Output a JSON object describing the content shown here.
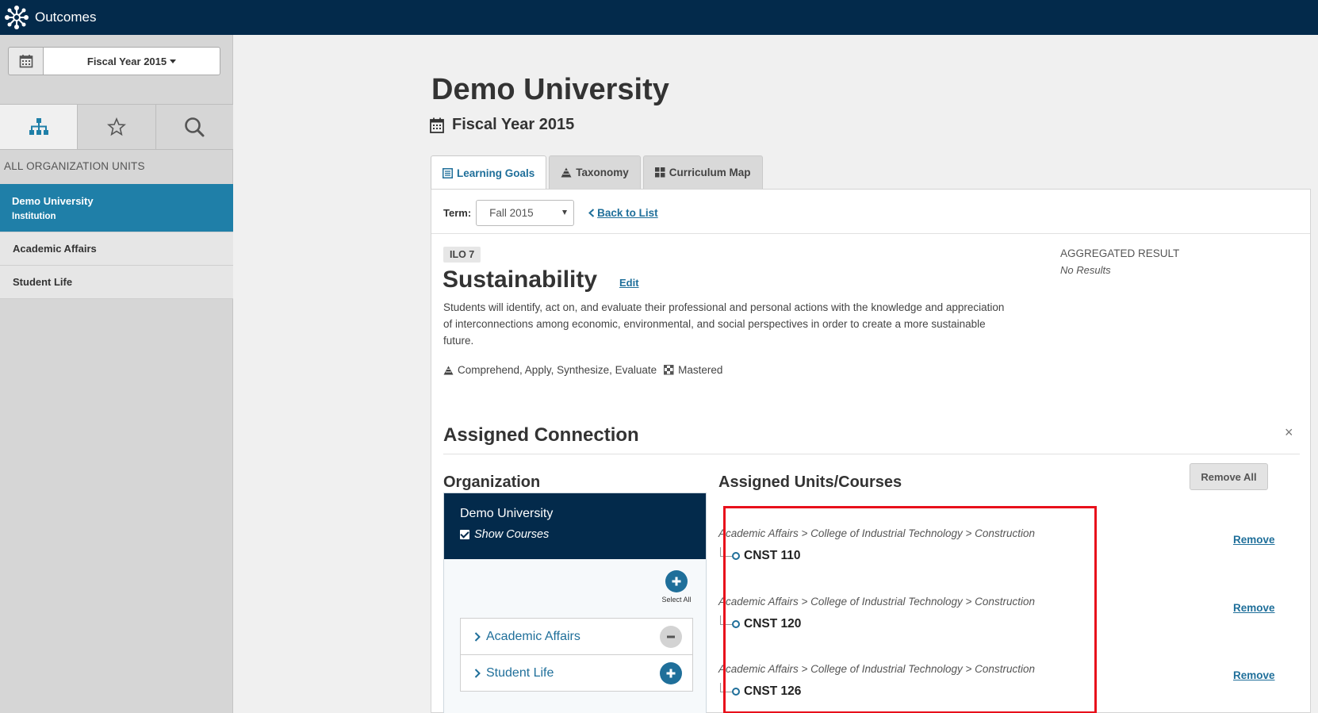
{
  "topbar": {
    "app_title": "Outcomes"
  },
  "sidebar": {
    "fiscal_year_label": "Fiscal Year 2015",
    "heading": "ALL ORGANIZATION UNITS",
    "tabs": [
      {
        "icon": "org-chart-icon"
      },
      {
        "icon": "star-icon"
      },
      {
        "icon": "search-icon"
      }
    ],
    "units": [
      {
        "name": "Demo University",
        "type": "Institution"
      },
      {
        "name": "Academic Affairs"
      },
      {
        "name": "Student Life"
      }
    ]
  },
  "page": {
    "title": "Demo University",
    "fiscal_year": "Fiscal Year 2015"
  },
  "tabs": [
    {
      "label": "Learning Goals",
      "icon": "list-icon"
    },
    {
      "label": "Taxonomy",
      "icon": "pyramid-icon"
    },
    {
      "label": "Curriculum Map",
      "icon": "grid-icon"
    }
  ],
  "term": {
    "label": "Term:",
    "selected": "Fall 2015",
    "back_label": "Back to List"
  },
  "goal": {
    "badge": "ILO 7",
    "title": "Sustainability",
    "edit_label": "Edit",
    "description": "Students will identify, act on, and evaluate their professional and personal actions with the knowledge and appreciation of interconnections among economic, environmental, and social perspectives in order to create a more sustainable future.",
    "taxonomy": "Comprehend, Apply, Synthesize, Evaluate",
    "mastery": "Mastered",
    "aggregated_label": "AGGREGATED RESULT",
    "aggregated_value": "No Results"
  },
  "connection": {
    "title": "Assigned Connection",
    "close": "×",
    "organization_heading": "Organization",
    "org_box": {
      "name": "Demo University",
      "show_courses": "Show Courses",
      "select_all": "Select All",
      "children": [
        {
          "name": "Academic Affairs",
          "state": "minus"
        },
        {
          "name": "Student Life",
          "state": "plus"
        }
      ]
    },
    "assigned_heading": "Assigned Units/Courses",
    "remove_all_label": "Remove All",
    "items": [
      {
        "path": "Academic Affairs > College of Industrial Technology > Construction",
        "course": "CNST 110",
        "remove": "Remove"
      },
      {
        "path": "Academic Affairs > College of Industrial Technology > Construction",
        "course": "CNST 120",
        "remove": "Remove"
      },
      {
        "path": "Academic Affairs > College of Industrial Technology > Construction",
        "course": "CNST 126",
        "remove": "Remove"
      }
    ]
  },
  "colors": {
    "navy": "#032a4b",
    "accent_blue": "#1f7fa8",
    "link_blue": "#1f6f9a",
    "highlight_red": "#e8101b"
  }
}
